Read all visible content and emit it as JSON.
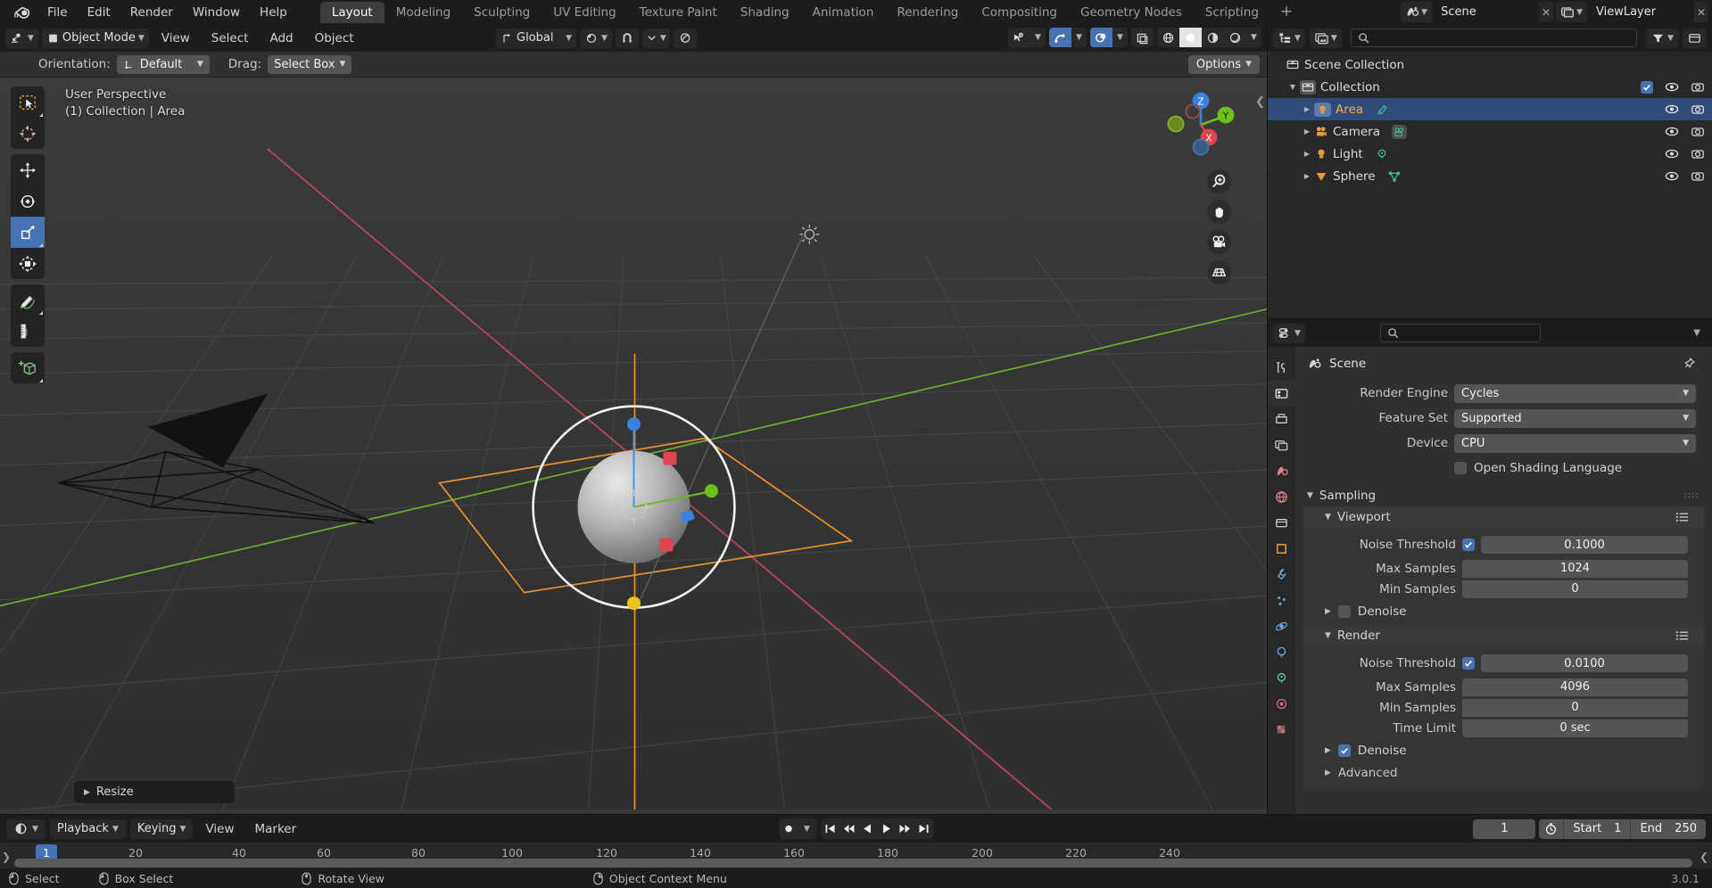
{
  "app": {
    "version": "3.0.1",
    "accent_blue": "#4772b3",
    "selected_orange": "#ffa847",
    "panel_bg": "#303030",
    "header_bg": "#1d1d1d"
  },
  "topbar": {
    "logo_icon": "blender-logo-icon",
    "menus": [
      "File",
      "Edit",
      "Render",
      "Window",
      "Help"
    ],
    "workspace_tabs": [
      {
        "label": "Layout",
        "active": true
      },
      {
        "label": "Modeling",
        "active": false
      },
      {
        "label": "Sculpting",
        "active": false
      },
      {
        "label": "UV Editing",
        "active": false
      },
      {
        "label": "Texture Paint",
        "active": false
      },
      {
        "label": "Shading",
        "active": false
      },
      {
        "label": "Animation",
        "active": false
      },
      {
        "label": "Rendering",
        "active": false
      },
      {
        "label": "Compositing",
        "active": false
      },
      {
        "label": "Geometry Nodes",
        "active": false
      },
      {
        "label": "Scripting",
        "active": false
      }
    ],
    "add_workspace_label": "+",
    "scene_name": "Scene",
    "viewlayer_name": "ViewLayer"
  },
  "viewport_header": {
    "mode": "Object Mode",
    "menus": [
      "View",
      "Select",
      "Add",
      "Object"
    ],
    "transform_orientation": "Global",
    "snap_label": "snap-magnet-icon",
    "proportional_label": "proportional-editing-icon"
  },
  "tool_settings": {
    "orientation_label": "Orientation:",
    "orientation_value": "Default",
    "drag_label": "Drag:",
    "drag_value": "Select Box",
    "options_label": "Options"
  },
  "viewport": {
    "overlay_line1": "User Perspective",
    "overlay_line2": "(1) Collection | Area",
    "operator_panel": "Resize",
    "gizmo_axes": [
      "Z",
      "Y",
      "X"
    ],
    "toolbar_tools": [
      {
        "name": "tweak-select-tool",
        "icon": "cursor-box-select-icon",
        "active": false
      },
      {
        "name": "cursor-tool",
        "icon": "3d-cursor-icon",
        "active": false
      },
      {
        "name": "move-tool",
        "icon": "move-arrows-icon",
        "active": false
      },
      {
        "name": "rotate-tool",
        "icon": "rotate-icon",
        "active": false
      },
      {
        "name": "scale-tool",
        "icon": "scale-icon",
        "active": true
      },
      {
        "name": "transform-tool",
        "icon": "transform-icon",
        "active": false
      },
      {
        "name": "annotate-tool",
        "icon": "pencil-annotate-icon",
        "active": false
      },
      {
        "name": "measure-tool",
        "icon": "ruler-measure-icon",
        "active": false
      },
      {
        "name": "add-cube-tool",
        "icon": "add-cube-icon",
        "active": false
      }
    ],
    "nav_buttons": [
      "zoom-icon",
      "hand-pan-icon",
      "camera-view-icon",
      "ortho-persp-icon"
    ]
  },
  "outliner": {
    "display_mode_icon": "outliner-display-icon",
    "filter_icon": "filter-icon",
    "search_placeholder": "",
    "rows": [
      {
        "label": "Scene Collection",
        "icon": "collection-icon",
        "indent": 0,
        "expandable": false,
        "selected": false,
        "show_checkbox": false,
        "show_eye": false,
        "show_camera": false
      },
      {
        "label": "Collection",
        "icon": "collection-icon",
        "indent": 1,
        "expandable": true,
        "expanded": true,
        "selected": false,
        "show_checkbox": true,
        "show_eye": true,
        "show_camera": true
      },
      {
        "label": "Area",
        "icon": "light-area-icon",
        "data_icon": "light-data-icon",
        "indent": 2,
        "expandable": true,
        "expanded": false,
        "selected": true,
        "show_checkbox": false,
        "show_eye": true,
        "show_camera": true
      },
      {
        "label": "Camera",
        "icon": "camera-object-icon",
        "data_icon": "camera-data-icon",
        "indent": 2,
        "expandable": true,
        "expanded": false,
        "selected": false,
        "show_checkbox": false,
        "show_eye": true,
        "show_camera": true
      },
      {
        "label": "Light",
        "icon": "light-object-icon",
        "data_icon": "light-point-data-icon",
        "indent": 2,
        "expandable": true,
        "expanded": false,
        "selected": false,
        "show_checkbox": false,
        "show_eye": true,
        "show_camera": true
      },
      {
        "label": "Sphere",
        "icon": "mesh-object-icon",
        "data_icon": "mesh-data-icon",
        "indent": 2,
        "expandable": true,
        "expanded": false,
        "selected": false,
        "show_checkbox": false,
        "show_eye": true,
        "show_camera": true
      }
    ]
  },
  "properties": {
    "editor_type_icon": "properties-editor-icon",
    "search_placeholder": "",
    "breadcrumb": "Scene",
    "breadcrumb_icon": "scene-icon",
    "pin_icon": "pin-icon",
    "tabs": [
      {
        "name": "tool",
        "icon": "wrench-screwdriver-icon",
        "active": false
      },
      {
        "name": "render",
        "icon": "camera-back-icon",
        "active": true
      },
      {
        "name": "output",
        "icon": "printer-output-icon",
        "active": false
      },
      {
        "name": "view-layer",
        "icon": "images-viewlayer-icon",
        "active": false
      },
      {
        "name": "scene",
        "icon": "scene-cone-icon",
        "active": false
      },
      {
        "name": "world",
        "icon": "world-globe-icon",
        "active": false
      },
      {
        "name": "collection",
        "icon": "collection-props-icon",
        "active": false
      },
      {
        "name": "object",
        "icon": "object-square-icon",
        "active": false
      },
      {
        "name": "modifiers",
        "icon": "wrench-icon",
        "active": false
      },
      {
        "name": "particles",
        "icon": "particles-icon",
        "active": false
      },
      {
        "name": "physics",
        "icon": "physics-orbit-icon",
        "active": false
      },
      {
        "name": "constraints",
        "icon": "constraints-icon",
        "active": false
      },
      {
        "name": "data",
        "icon": "light-data-green-icon",
        "active": false
      },
      {
        "name": "material",
        "icon": "material-sphere-icon",
        "active": false
      },
      {
        "name": "texture",
        "icon": "texture-checker-icon",
        "active": false
      }
    ],
    "fields": [
      {
        "label": "Render Engine",
        "value": "Cycles",
        "type": "dropdown"
      },
      {
        "label": "Feature Set",
        "value": "Supported",
        "type": "dropdown"
      },
      {
        "label": "Device",
        "value": "CPU",
        "type": "dropdown"
      }
    ],
    "osl_label": "Open Shading Language",
    "osl_checked": false,
    "sampling": {
      "title": "Sampling",
      "viewport": {
        "title": "Viewport",
        "noise_threshold_label": "Noise Threshold",
        "noise_threshold_value": "0.1000",
        "noise_threshold_enabled": true,
        "max_samples_label": "Max Samples",
        "max_samples_value": "1024",
        "min_samples_label": "Min Samples",
        "min_samples_value": "0",
        "denoise_label": "Denoise",
        "denoise_enabled": false
      },
      "render": {
        "title": "Render",
        "noise_threshold_label": "Noise Threshold",
        "noise_threshold_value": "0.0100",
        "noise_threshold_enabled": true,
        "max_samples_label": "Max Samples",
        "max_samples_value": "4096",
        "min_samples_label": "Min Samples",
        "min_samples_value": "0",
        "time_limit_label": "Time Limit",
        "time_limit_value": "0 sec",
        "denoise_label": "Denoise",
        "denoise_enabled": true
      },
      "advanced_label": "Advanced"
    }
  },
  "timeline": {
    "editor_icon": "timeline-editor-icon",
    "menus": [
      {
        "label": "Playback",
        "dropdown": true
      },
      {
        "label": "Keying",
        "dropdown": true
      },
      {
        "label": "View",
        "dropdown": false
      },
      {
        "label": "Marker",
        "dropdown": false
      }
    ],
    "record_icon": "record-keyframe-icon",
    "transport": [
      "jump-start-icon",
      "prev-keyframe-icon",
      "play-reverse-icon",
      "play-icon",
      "next-keyframe-icon",
      "jump-end-icon"
    ],
    "current_frame": "1",
    "start_label": "Start",
    "start_value": "1",
    "end_label": "End",
    "end_value": "250",
    "ticks": [
      20,
      40,
      60,
      80,
      100,
      120,
      140,
      160,
      180,
      200,
      220,
      240
    ],
    "playhead_frame": "1"
  },
  "status_bar": {
    "items": [
      {
        "icon": "mouse-left-icon",
        "label": "Select"
      },
      {
        "icon": "mouse-left-drag-icon",
        "label": "Box Select"
      },
      {
        "icon": "mouse-middle-icon",
        "label": "Rotate View"
      },
      {
        "icon": "mouse-right-icon",
        "label": "Object Context Menu"
      }
    ],
    "version": "3.0.1"
  }
}
